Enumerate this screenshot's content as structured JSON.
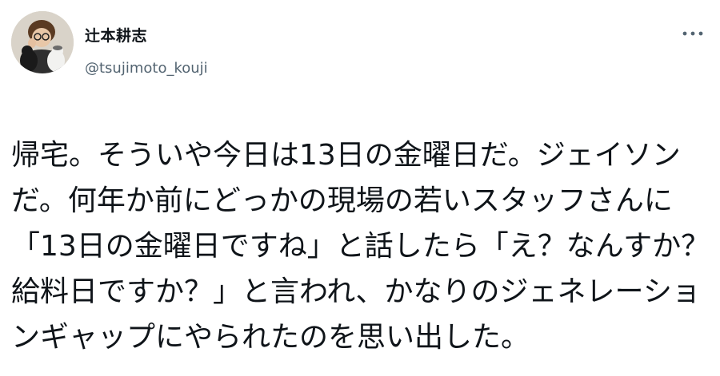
{
  "user": {
    "display_name": "辻本耕志",
    "handle": "@tsujimoto_kouji",
    "avatar_icon": "avatar-photo",
    "more_icon": "more-options-icon"
  },
  "tweet": {
    "lines": [
      "帰宅。そういや今日は13日の金曜日だ。ジェイソン",
      "だ。何年か前にどっかの現場の若いスタッフさんに",
      "「13日の金曜日ですね」と話したら「え？なんすか？",
      "給料日ですか？」と言われ、かなりのジェネレーショ",
      "ンギャップにやられたのを思い出した。"
    ]
  },
  "colors": {
    "text": "#0f1419",
    "secondary": "#536471",
    "background": "#ffffff"
  }
}
